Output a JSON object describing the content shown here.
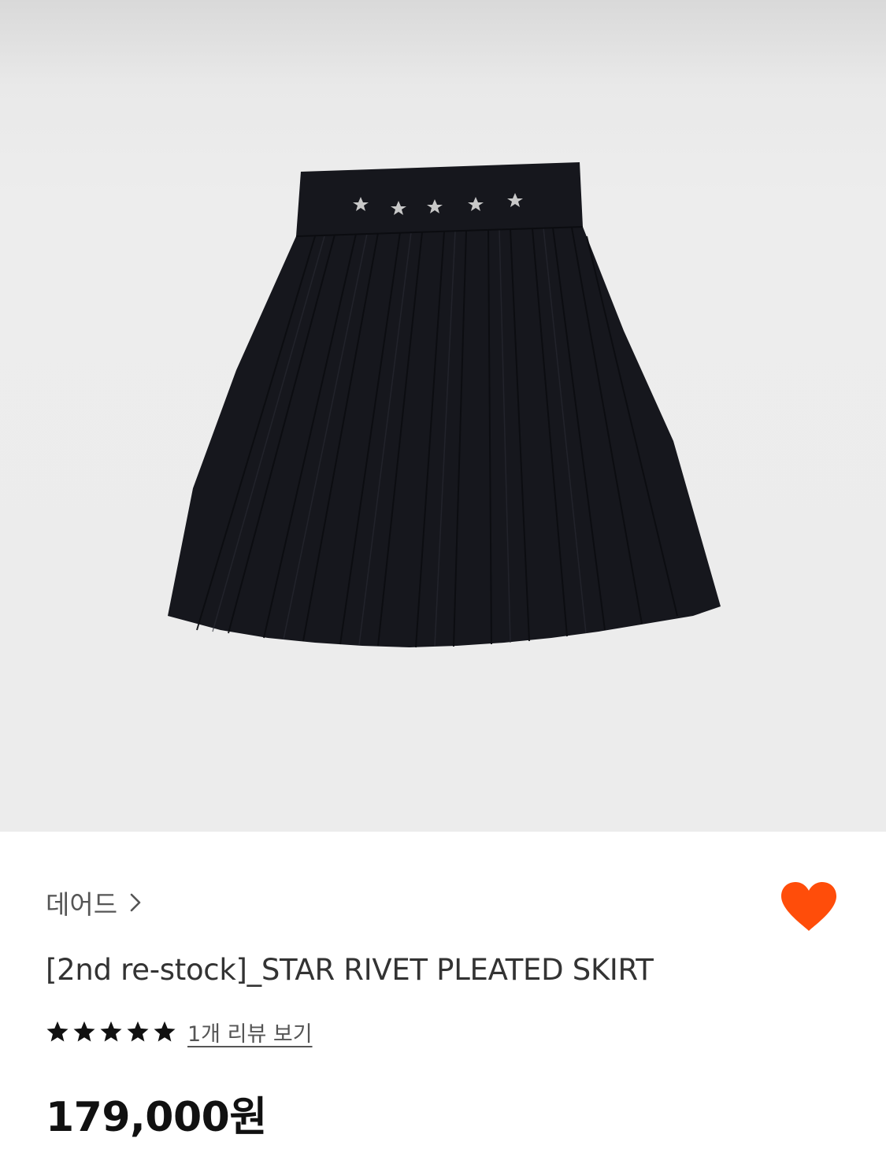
{
  "product": {
    "image_alt": "black pleated skirt with silver star rivets on waistband",
    "brand": "데어드",
    "brand_chevron_icon": "chevron-right-icon",
    "wishlist_icon": "heart-icon",
    "wishlist_color": "#ff4d0a",
    "title": "[2nd re-stock]_STAR RIVET PLEATED SKIRT",
    "rating": 5,
    "rating_max": 5,
    "review_link": "1개 리뷰 보기",
    "price": "179,000원"
  },
  "colors": {
    "hero_bg": "#ececec",
    "skirt": "#16171d",
    "rivet": "#c8c8c8",
    "star_fill": "#111111"
  }
}
